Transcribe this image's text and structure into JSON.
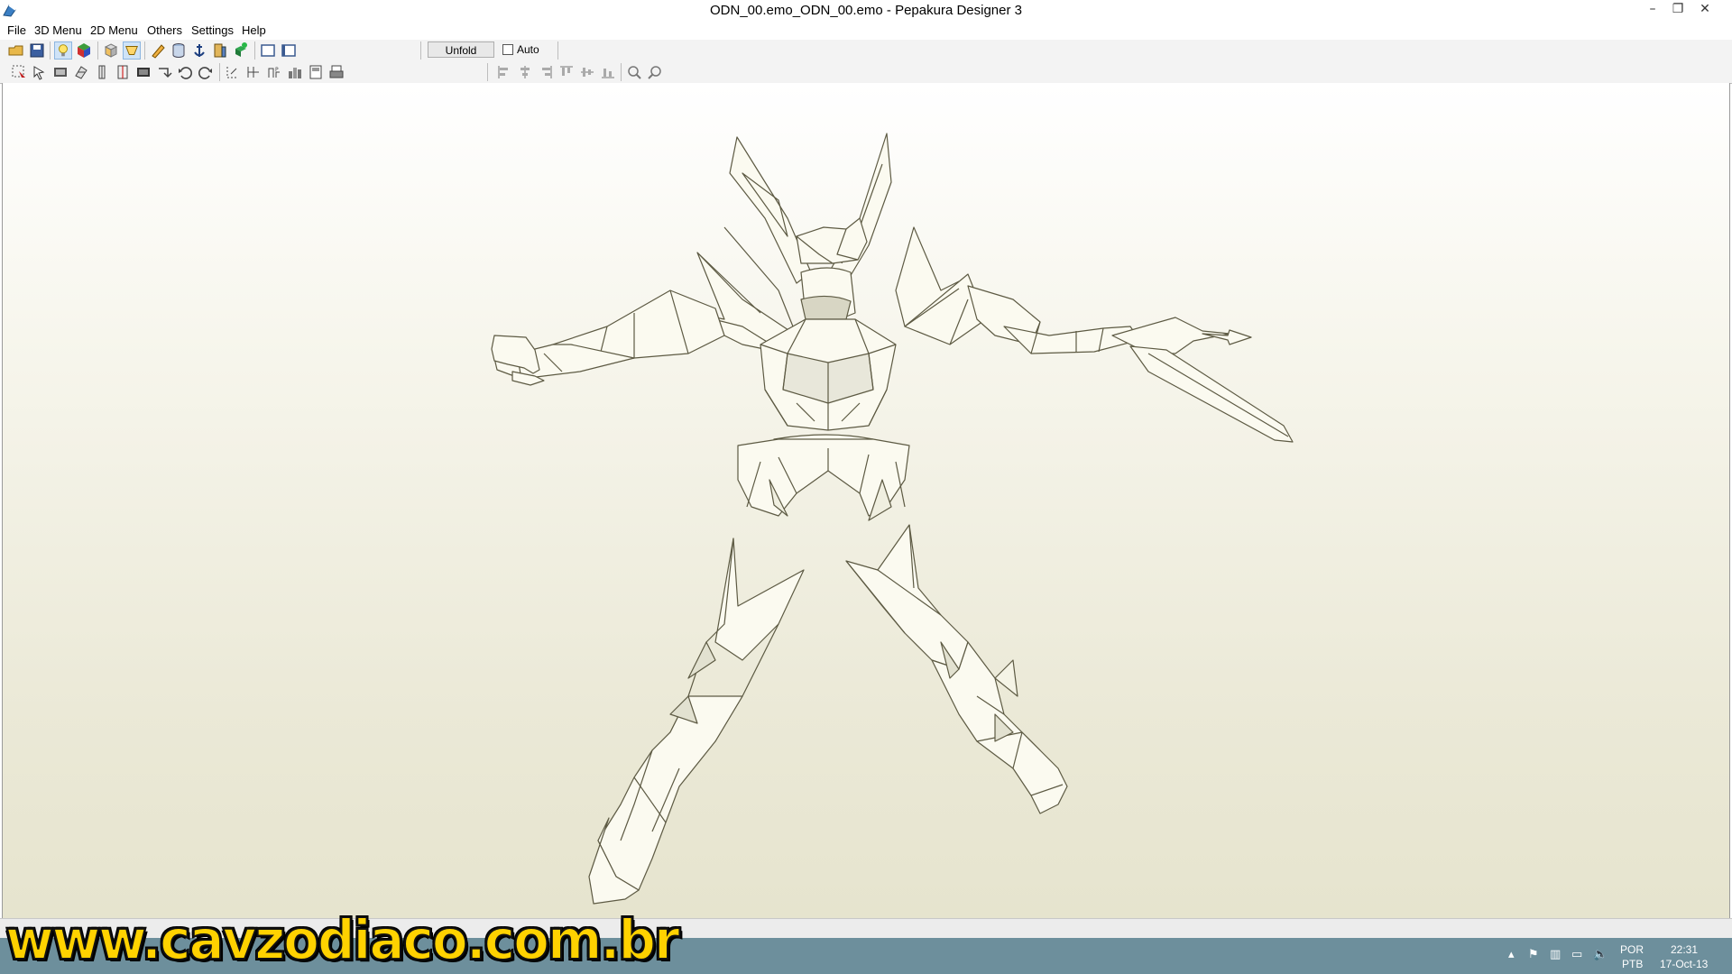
{
  "window": {
    "title": "ODN_00.emo_ODN_00.emo - Pepakura Designer 3"
  },
  "menu": {
    "file": "File",
    "menu3d": "3D Menu",
    "menu2d": "2D Menu",
    "others": "Others",
    "settings": "Settings",
    "help": "Help"
  },
  "toolbar": {
    "unfold_label": "Unfold",
    "auto_label": "Auto",
    "auto_checked": false,
    "icons_row1": [
      "open-icon",
      "save-icon",
      "light-icon",
      "color-cube-icon",
      "texture-cube-icon",
      "flap-icon",
      "pen-icon",
      "cylinder-icon",
      "anchor-icon",
      "book-icon",
      "paint-cube-icon",
      "single-view-icon",
      "split-view-icon"
    ],
    "icons_row2": [
      "select-icon",
      "move-icon",
      "film-icon",
      "rotate-parts-icon",
      "join-icon",
      "split-icon",
      "image-icon",
      "flip-icon",
      "undo-icon",
      "redo-icon",
      "edit-line-icon",
      "edit-flap-icon",
      "page-icon",
      "layout-icon",
      "frame-icon",
      "print-icon",
      "align-left-icon",
      "align-center-icon",
      "align-right-icon",
      "align-top-icon",
      "align-middle-icon",
      "align-bottom-icon",
      "zoom-in-icon",
      "zoom-out-icon"
    ]
  },
  "taskbar": {
    "language": "POR",
    "keyboard": "PTB",
    "time": "22:31",
    "date": "17-Oct-13"
  },
  "watermark": {
    "text": "www.cavzodiaco.com.br"
  },
  "colors": {
    "canvas_top": "#ffffff",
    "canvas_bottom": "#e6e4ce",
    "model_fill": "#fbfaf0",
    "model_edge": "#5d5a43",
    "taskbar": "#6d8f9c",
    "watermark": "#ffd200"
  }
}
